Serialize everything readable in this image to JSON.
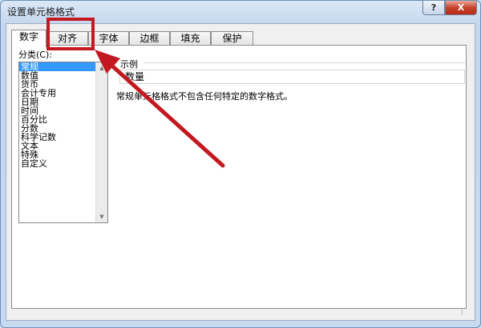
{
  "window": {
    "title": "设置单元格格式",
    "help_label": "?",
    "close_label": "X"
  },
  "tabs": [
    {
      "label": "数字",
      "active": true
    },
    {
      "label": "对齐",
      "active": false
    },
    {
      "label": "字体",
      "active": false
    },
    {
      "label": "边框",
      "active": false
    },
    {
      "label": "填充",
      "active": false
    },
    {
      "label": "保护",
      "active": false
    }
  ],
  "category": {
    "label": "分类(C):",
    "items": [
      "常规",
      "数值",
      "货币",
      "会计专用",
      "日期",
      "时间",
      "百分比",
      "分数",
      "科学记数",
      "文本",
      "特殊",
      "自定义"
    ],
    "selected": "常规"
  },
  "sample": {
    "legend": "示例",
    "value": "数量"
  },
  "description": "常规单元格格式不包含任何特定的数字格式。",
  "annotation": {
    "color": "#c3181f"
  }
}
